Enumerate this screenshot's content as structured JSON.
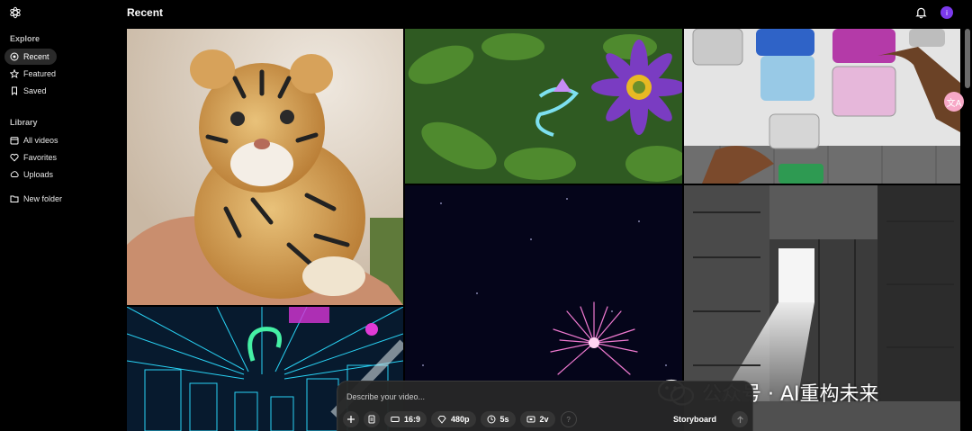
{
  "header": {
    "title": "Recent"
  },
  "sidebar": {
    "explore_title": "Explore",
    "explore": [
      {
        "label": "Recent",
        "icon": "recent-icon",
        "active": true
      },
      {
        "label": "Featured",
        "icon": "star-icon"
      },
      {
        "label": "Saved",
        "icon": "bookmark-icon"
      }
    ],
    "library_title": "Library",
    "library": [
      {
        "label": "All videos",
        "icon": "calendar-icon"
      },
      {
        "label": "Favorites",
        "icon": "heart-icon"
      },
      {
        "label": "Uploads",
        "icon": "upload-icon"
      }
    ],
    "new_folder": {
      "label": "New folder",
      "icon": "folder-plus-icon"
    }
  },
  "user": {
    "avatar_initial": "i"
  },
  "composer": {
    "placeholder": "Describe your video...",
    "aspect": "16:9",
    "resolution": "480p",
    "duration": "5s",
    "variations": "2v",
    "help": "?",
    "storyboard": "Storyboard"
  },
  "badge": {
    "translate": "文A"
  },
  "watermark": {
    "text": "公众号 · AI重构未来"
  },
  "colors": {
    "accent": "#7c3aed",
    "background": "#000000",
    "composer_bg": "#262626"
  }
}
